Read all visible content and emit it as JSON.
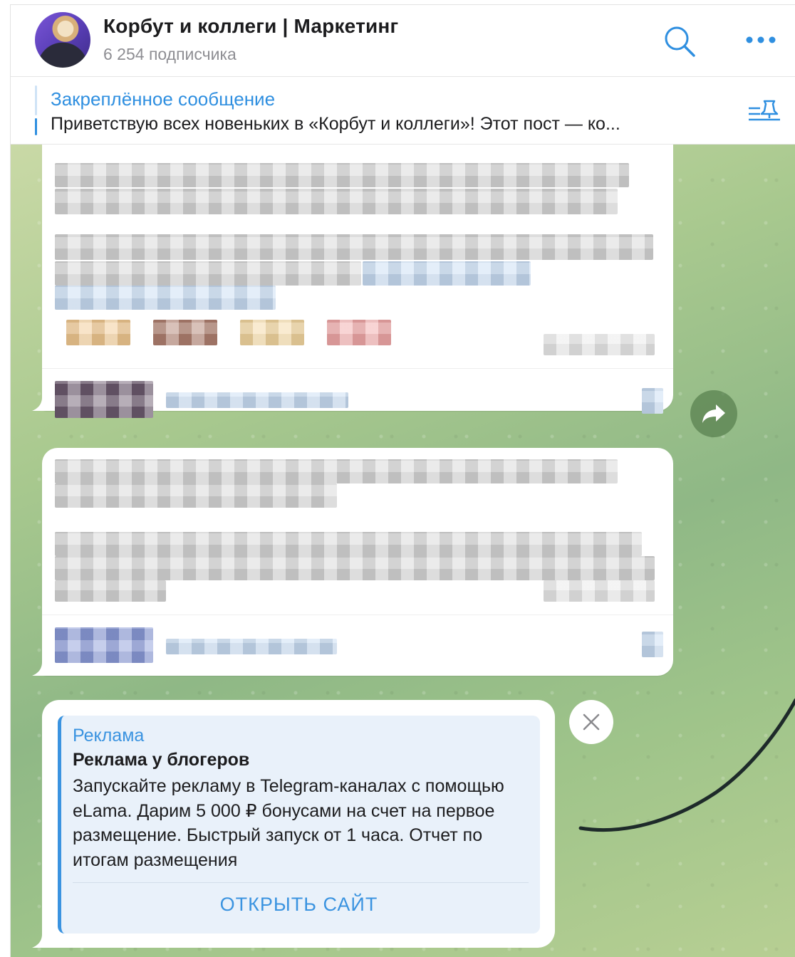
{
  "header": {
    "title": "Корбут и коллеги | Маркетинг",
    "subscribers": "6 254 подписчика"
  },
  "pinned": {
    "label": "Закреплённое сообщение",
    "text": "Приветствую всех новеньких в «Корбут и коллеги»!  Этот пост — ко..."
  },
  "ad": {
    "label": "Реклама",
    "title": "Реклама у блогеров",
    "body": "Запускайте рекламу в Telegram-каналах с помощью eLama. Дарим 5 000 ₽ бонусами на счет на первое размещение. Быстрый запуск от 1 часа. Отчет по итогам размещения",
    "button_label": "ОТКРЫТЬ САЙТ"
  },
  "colors": {
    "accent": "#3a93e0",
    "chat_background": "#a9c98f"
  },
  "icons": [
    "search-icon",
    "more-icon",
    "pin-list-icon",
    "forward-icon",
    "close-icon"
  ]
}
